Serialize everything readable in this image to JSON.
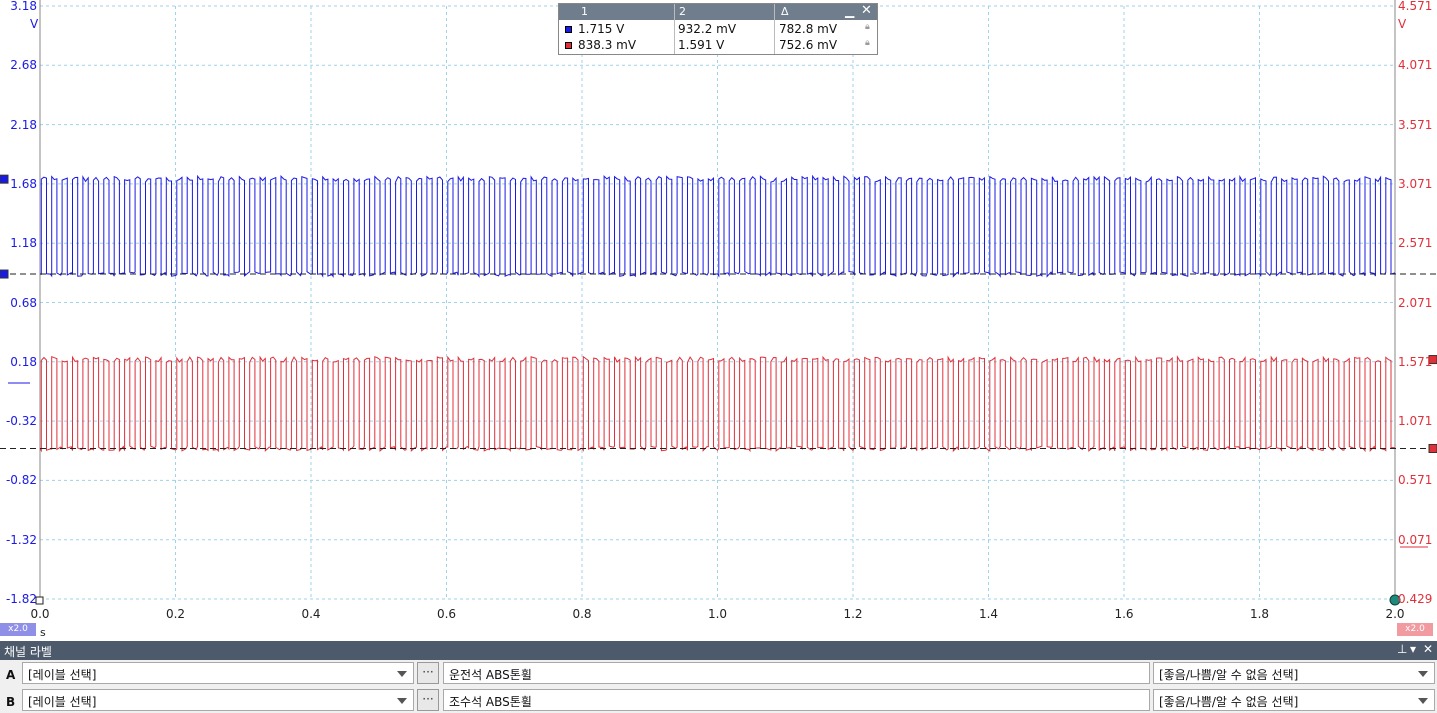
{
  "colors": {
    "channel_a": "#1a1ae6",
    "channel_b": "#e0303a",
    "grid": "#9fd3e8",
    "panel_title": "#4d5a6b"
  },
  "left_axis": {
    "unit": "V",
    "ticks": [
      "3.18",
      "2.68",
      "2.18",
      "1.68",
      "1.18",
      "0.68",
      "0.18",
      "-0.32",
      "-0.82",
      "-1.32",
      "-1.82"
    ]
  },
  "right_axis": {
    "unit": "V",
    "ticks": [
      "4.571",
      "4.071",
      "3.571",
      "3.071",
      "2.571",
      "2.071",
      "1.571",
      "1.071",
      "0.571",
      "0.071",
      "0.429"
    ]
  },
  "time_axis": {
    "unit": "s",
    "ticks": [
      "0.0",
      "0.2",
      "0.4",
      "0.6",
      "0.8",
      "1.0",
      "1.2",
      "1.4",
      "1.6",
      "1.8",
      "2.0"
    ],
    "left_zoom": "x2.0",
    "right_zoom": "x2.0"
  },
  "cursor_table": {
    "headers": [
      "1",
      "2",
      "Δ"
    ],
    "rows": [
      {
        "c1": "1.715 V",
        "c2": "932.2 mV",
        "delta": "782.8 mV"
      },
      {
        "c1": "838.3 mV",
        "c2": "1.591 V",
        "delta": "752.6 mV"
      }
    ]
  },
  "chart_data": {
    "type": "line",
    "xlim": [
      0,
      2.0
    ],
    "xlabel": "s",
    "series": [
      {
        "name": "A",
        "axis": "left",
        "low": 0.92,
        "high": 1.72,
        "pulses": 130
      },
      {
        "name": "B",
        "axis": "right",
        "low": 0.84,
        "high": 1.59,
        "pulses": 130
      }
    ]
  },
  "channel_labels": {
    "title": "채널 라벨",
    "rows": [
      {
        "id": "A",
        "label_select": "[레이블 선택]",
        "name": "운전석 ABS톤휠",
        "quality_select": "[좋음/나쁨/알 수 없음 선택]"
      },
      {
        "id": "B",
        "label_select": "[레이블 선택]",
        "name": "조수석 ABS톤휠",
        "quality_select": "[좋음/나쁨/알 수 없음 선택]"
      }
    ]
  }
}
